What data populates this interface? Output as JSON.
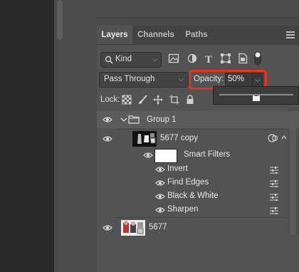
{
  "tabs": [
    {
      "label": "Layers",
      "active": true
    },
    {
      "label": "Channels",
      "active": false
    },
    {
      "label": "Paths",
      "active": false
    }
  ],
  "filter": {
    "kind_label": "Kind"
  },
  "blend_mode": "Pass Through",
  "opacity": {
    "label": "Opacity:",
    "value": "50%",
    "slider_fraction": 0.5
  },
  "lock": {
    "label": "Lock:"
  },
  "layers": {
    "group": {
      "name": "Group 1"
    },
    "smart_object": {
      "name": "5677 copy",
      "smart_filters_label": "Smart Filters"
    },
    "filters": [
      "Invert",
      "Find Edges",
      "Black & White",
      "Sharpen"
    ],
    "base": {
      "name": "5677"
    }
  },
  "colors": {
    "highlight": "#e8321f",
    "panel": "#535353"
  }
}
